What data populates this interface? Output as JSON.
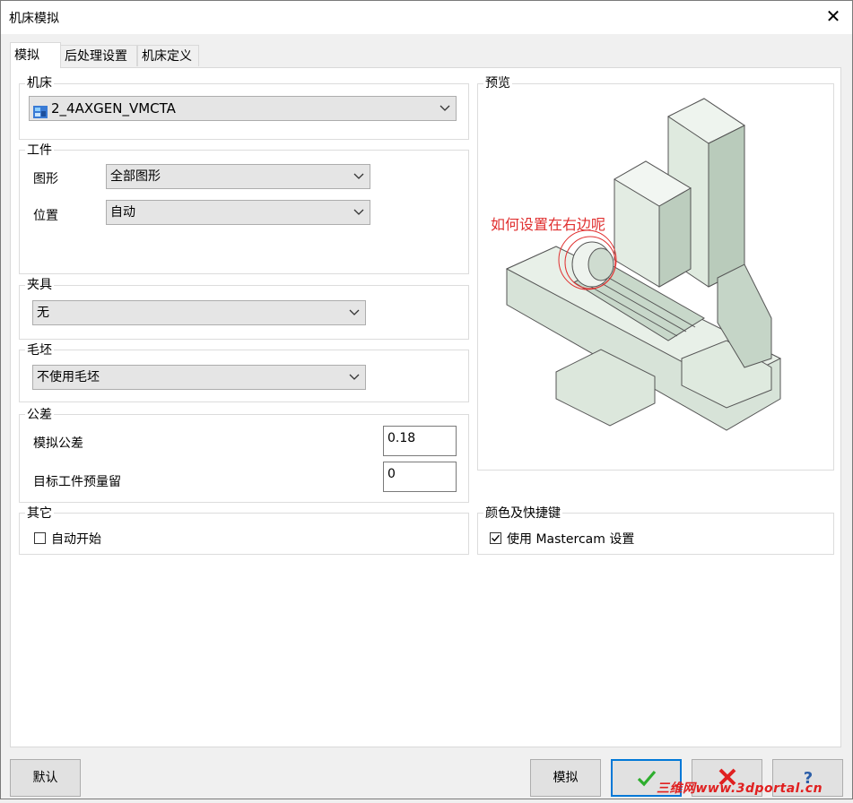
{
  "window": {
    "title": "机床模拟"
  },
  "tabs": [
    {
      "label": "模拟",
      "active": true
    },
    {
      "label": "后处理设置",
      "active": false
    },
    {
      "label": "机床定义",
      "active": false
    }
  ],
  "machine": {
    "group_label": "机床",
    "selected": "2_4AXGEN_VMCTA"
  },
  "workpiece": {
    "group_label": "工件",
    "graphics_label": "图形",
    "graphics_value": "全部图形",
    "position_label": "位置",
    "position_value": "自动"
  },
  "fixture": {
    "group_label": "夹具",
    "value": "无"
  },
  "stock": {
    "group_label": "毛坯",
    "value": "不使用毛坯"
  },
  "tolerance": {
    "group_label": "公差",
    "sim_label": "模拟公差",
    "sim_value": "0.18",
    "stock_label": "目标工件预量留",
    "stock_value": "0"
  },
  "other": {
    "group_label": "其它",
    "autostart_label": "自动开始",
    "autostart_checked": false
  },
  "preview": {
    "group_label": "预览",
    "annotation": "如何设置在右边呢"
  },
  "colors": {
    "group_label": "颜色及快捷键",
    "use_mastercam_label": "使用 Mastercam 设置",
    "use_mastercam_checked": true
  },
  "buttons": {
    "default_label": "默认",
    "simulate_label": "模拟",
    "ok_icon": "green-check-icon",
    "cancel_icon": "red-x-icon",
    "help_icon": "question-icon"
  },
  "watermark": "三维网www.3dportal.cn",
  "theme": {
    "accent": "#0078d7",
    "ok_green": "#2eae2e",
    "cancel_red": "#e02020",
    "annotation_red": "#e03030"
  }
}
